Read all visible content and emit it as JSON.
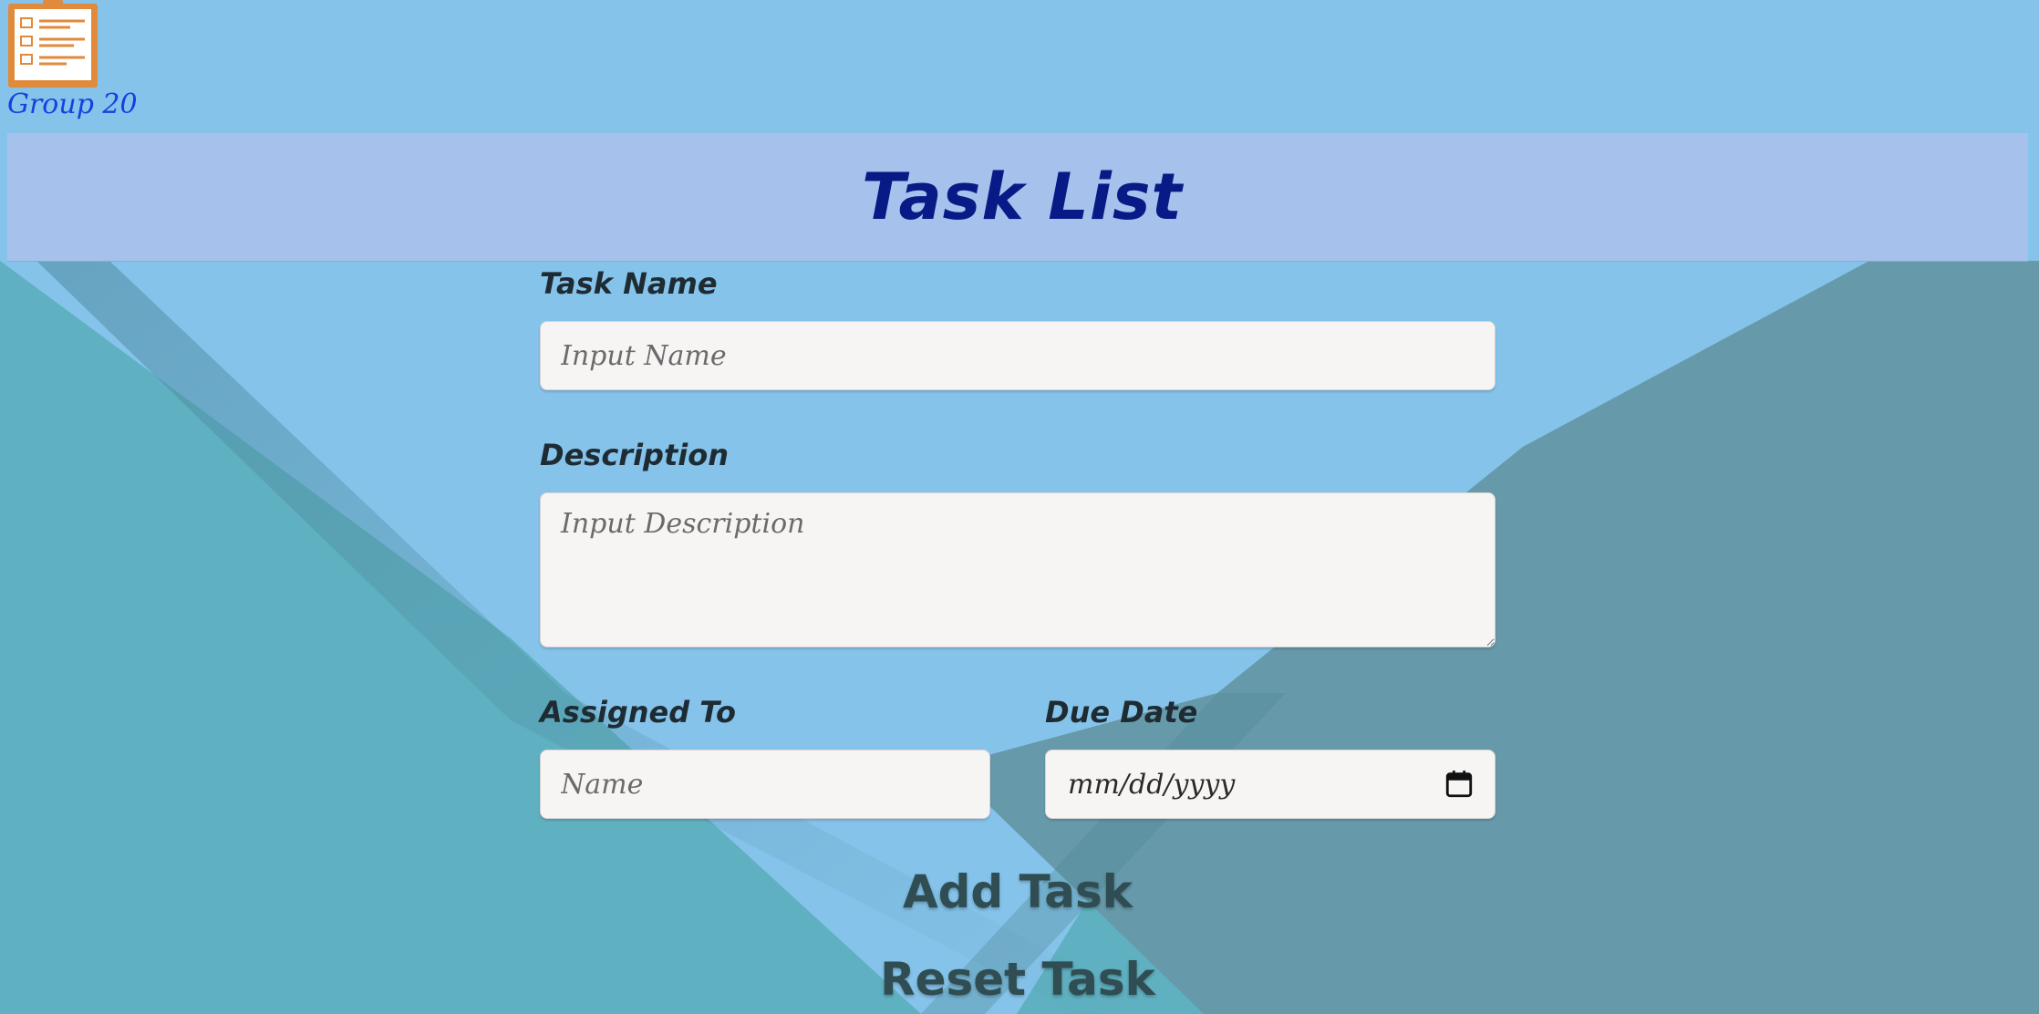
{
  "brand": {
    "logo_icon": "clipboard-checklist-icon",
    "group_label": "Group 20"
  },
  "header": {
    "title": "Task List"
  },
  "form": {
    "task_name": {
      "label": "Task Name",
      "placeholder": "Input Name",
      "value": ""
    },
    "description": {
      "label": "Description",
      "placeholder": "Input Description",
      "value": ""
    },
    "assigned_to": {
      "label": "Assigned To",
      "placeholder": "Name",
      "value": ""
    },
    "due_date": {
      "label": "Due Date",
      "placeholder": "mm/dd/yyyy",
      "icon": "calendar-icon"
    },
    "add_button_label": "Add Task",
    "reset_button_label": "Reset Task"
  },
  "colors": {
    "title_band": "#a6c2ec",
    "title_text": "#071a86",
    "group_label": "#1a3fe0",
    "sky_blue": "#85c3ea",
    "teal": "#5fb0c0",
    "slate_teal": "#6699aa",
    "field_bg": "#f7f4f4",
    "button_text": "#2f4d52",
    "logo_orange": "#e08a3c"
  }
}
